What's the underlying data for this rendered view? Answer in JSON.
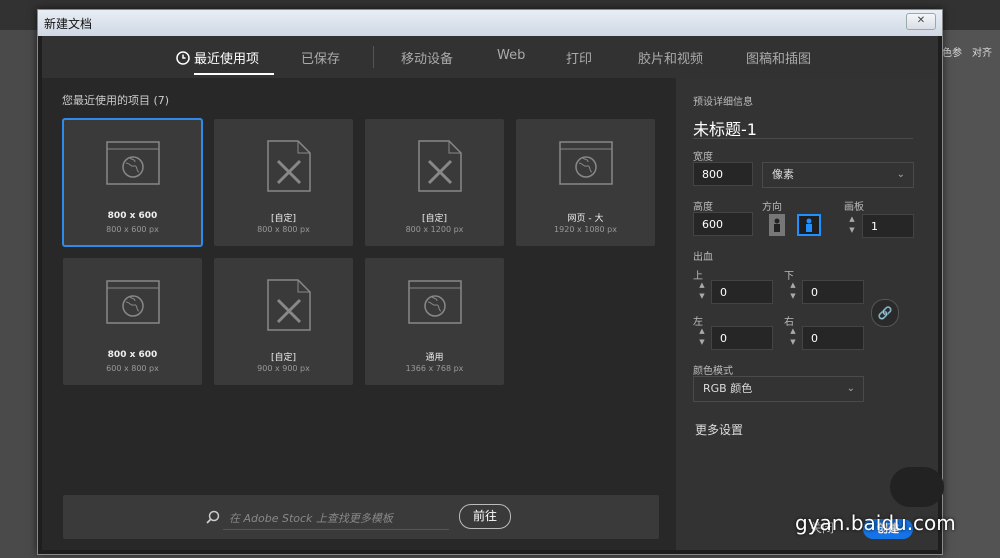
{
  "background": {
    "panel_tabs": [
      "色参",
      "对齐"
    ]
  },
  "dialog": {
    "title": "新建文档",
    "close_icon": "close-icon"
  },
  "tabs": [
    {
      "label": "最近使用项",
      "active": true
    },
    {
      "label": "已保存"
    },
    {
      "label": "移动设备"
    },
    {
      "label": "Web"
    },
    {
      "label": "打印"
    },
    {
      "label": "胶片和视频"
    },
    {
      "label": "图稿和插图"
    }
  ],
  "recent": {
    "label": "您最近使用的项目",
    "count": "(7)",
    "items": [
      {
        "name": "800 x 600",
        "size": "800 x 600 px",
        "icon": "web-icon",
        "selected": true
      },
      {
        "name": "[自定]",
        "size": "800 x 800 px",
        "icon": "custom-doc-icon"
      },
      {
        "name": "[自定]",
        "size": "800 x 1200 px",
        "icon": "custom-doc-icon"
      },
      {
        "name": "网页 - 大",
        "size": "1920 x 1080 px",
        "icon": "web-icon"
      },
      {
        "name": "800 x 600",
        "size": "600 x 800 px",
        "icon": "web-icon"
      },
      {
        "name": "[自定]",
        "size": "900 x 900 px",
        "icon": "custom-doc-icon"
      },
      {
        "name": "通用",
        "size": "1366 x 768 px",
        "icon": "web-icon"
      }
    ]
  },
  "search": {
    "placeholder": "在 Adobe Stock 上查找更多模板",
    "go_label": "前往"
  },
  "details": {
    "section_label": "预设详细信息",
    "doc_name": "未标题-1",
    "width_label": "宽度",
    "width_value": "800",
    "unit": "像素",
    "height_label": "高度",
    "height_value": "600",
    "orientation_label": "方向",
    "artboard_label": "画板",
    "artboard_value": "1",
    "bleed_label": "出血",
    "bleed_top_label": "上",
    "bleed_top": "0",
    "bleed_bottom_label": "下",
    "bleed_bottom": "0",
    "bleed_left_label": "左",
    "bleed_left": "0",
    "bleed_right_label": "右",
    "bleed_right": "0",
    "color_mode_label": "颜色模式",
    "color_mode": "RGB 颜色",
    "more_settings": "更多设置",
    "close_label": "关闭",
    "create_label": "创建"
  },
  "watermark": "gyan.baidu.com"
}
